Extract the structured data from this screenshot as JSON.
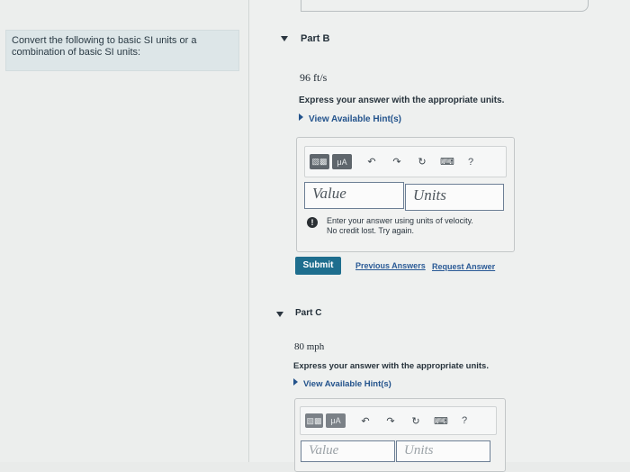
{
  "instructions": {
    "line1": "Convert the following to basic SI units or a",
    "line2": "combination of basic SI units:"
  },
  "part_b": {
    "title": "Part B",
    "question": "96 ft/s",
    "express": "Express your answer with the appropriate units.",
    "hint": "View Available Hint(s)",
    "toolbar": {
      "units_button": "μA",
      "help": "?"
    },
    "value_placeholder": "Value",
    "units_placeholder": "Units",
    "error_line1": "Enter your answer using units of velocity.",
    "error_line2": "No credit lost. Try again.",
    "submit": "Submit",
    "previous_answers": "Previous Answers",
    "request_answer": "Request Answer"
  },
  "part_c": {
    "title": "Part C",
    "question": "80 mph",
    "express": "Express your answer with the appropriate units.",
    "hint": "View Available Hint(s)",
    "toolbar": {
      "units_button": "μA",
      "help": "?"
    },
    "value_placeholder": "Value",
    "units_placeholder": "Units"
  },
  "colors": {
    "accent_submit": "#1e6e8e",
    "link": "#2a5a96",
    "field_border": "#6d7f95"
  }
}
